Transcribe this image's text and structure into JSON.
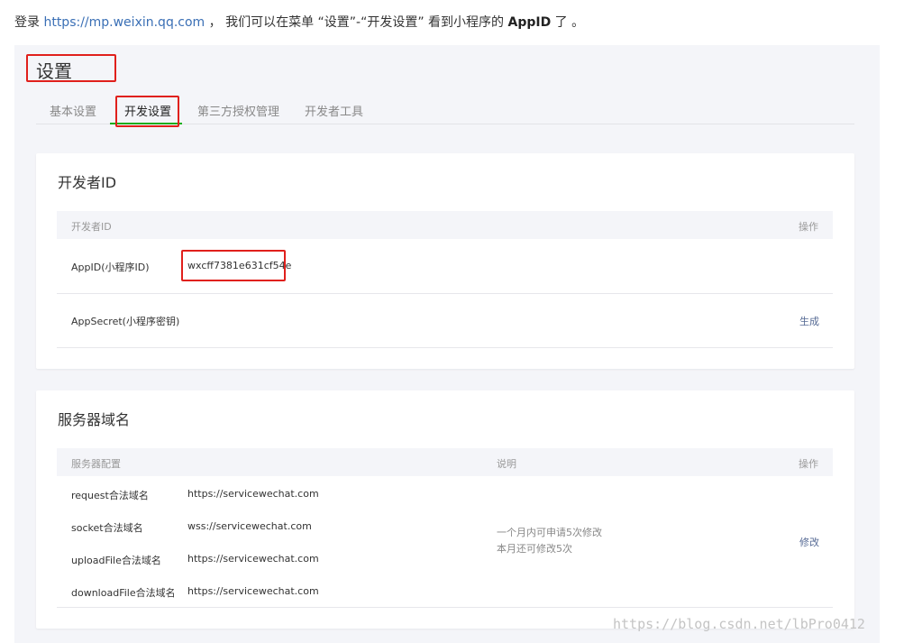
{
  "intro": {
    "prefix": "登录 ",
    "link": "https://mp.weixin.qq.com",
    "middle": " ，  我们可以在菜单 “设置”-“开发设置” 看到小程序的 ",
    "bold": "AppID",
    "suffix": " 了 。"
  },
  "page_title": "设置",
  "tabs": [
    "基本设置",
    "开发设置",
    "第三方授权管理",
    "开发者工具"
  ],
  "developer": {
    "title": "开发者ID",
    "header_id": "开发者ID",
    "header_action": "操作",
    "rows": [
      {
        "label": "AppID(小程序ID)",
        "value": "wxcff7381e631cf54e",
        "action": ""
      },
      {
        "label": "AppSecret(小程序密钥)",
        "value": "",
        "action": "生成"
      }
    ]
  },
  "server": {
    "title": "服务器域名",
    "header_config": "服务器配置",
    "header_desc": "说明",
    "header_action": "操作",
    "rows": [
      {
        "label": "request合法域名",
        "value": "https://servicewechat.com"
      },
      {
        "label": "socket合法域名",
        "value": "wss://servicewechat.com"
      },
      {
        "label": "uploadFile合法域名",
        "value": "https://servicewechat.com"
      },
      {
        "label": "downloadFile合法域名",
        "value": "https://servicewechat.com"
      }
    ],
    "desc_line1": "一个月内可申请5次修改",
    "desc_line2": "本月还可修改5次",
    "action": "修改"
  },
  "watermark": "https://blog.csdn.net/lbPro0412",
  "colors": {
    "highlight": "#e0201c",
    "active_tab": "#1aad19",
    "link": "#576b95",
    "panel_bg": "#f4f5f9"
  }
}
